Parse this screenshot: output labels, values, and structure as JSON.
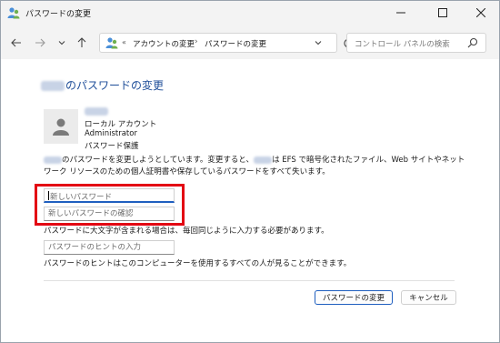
{
  "window": {
    "title": "パスワードの変更"
  },
  "nav": {
    "breadcrumb": [
      "アカウントの変更",
      "パスワードの変更"
    ],
    "breadcrumb_prefix": "«",
    "separator": "›",
    "search_placeholder": "コントロール パネルの検索"
  },
  "content": {
    "heading_suffix": "のパスワードの変更",
    "account": {
      "type": "ローカル アカウント",
      "group": "Administrator",
      "status": "パスワード保護"
    },
    "description": {
      "part1": "のパスワードを変更しようとしています。変更すると、",
      "part2": "は EFS で暗号化されたファイル、Web サイトやネットワーク リソースのための個人証明書や保存しているパスワードをすべて失います。"
    },
    "fields": {
      "new_password_placeholder": "新しいパスワード",
      "confirm_password_placeholder": "新しいパスワードの確認",
      "hint_placeholder": "パスワードのヒントの入力"
    },
    "notes": {
      "case_note": "パスワードに大文字が含まれる場合は、毎回同じように入力する必要があります。",
      "hint_note": "パスワードのヒントはこのコンピューターを使用するすべての人が見ることができます。"
    },
    "buttons": {
      "change": "パスワードの変更",
      "cancel": "キャンセル"
    }
  },
  "colors": {
    "accent": "#1f4e99",
    "highlight": "#e30613",
    "focus": "#1f5fbf"
  }
}
